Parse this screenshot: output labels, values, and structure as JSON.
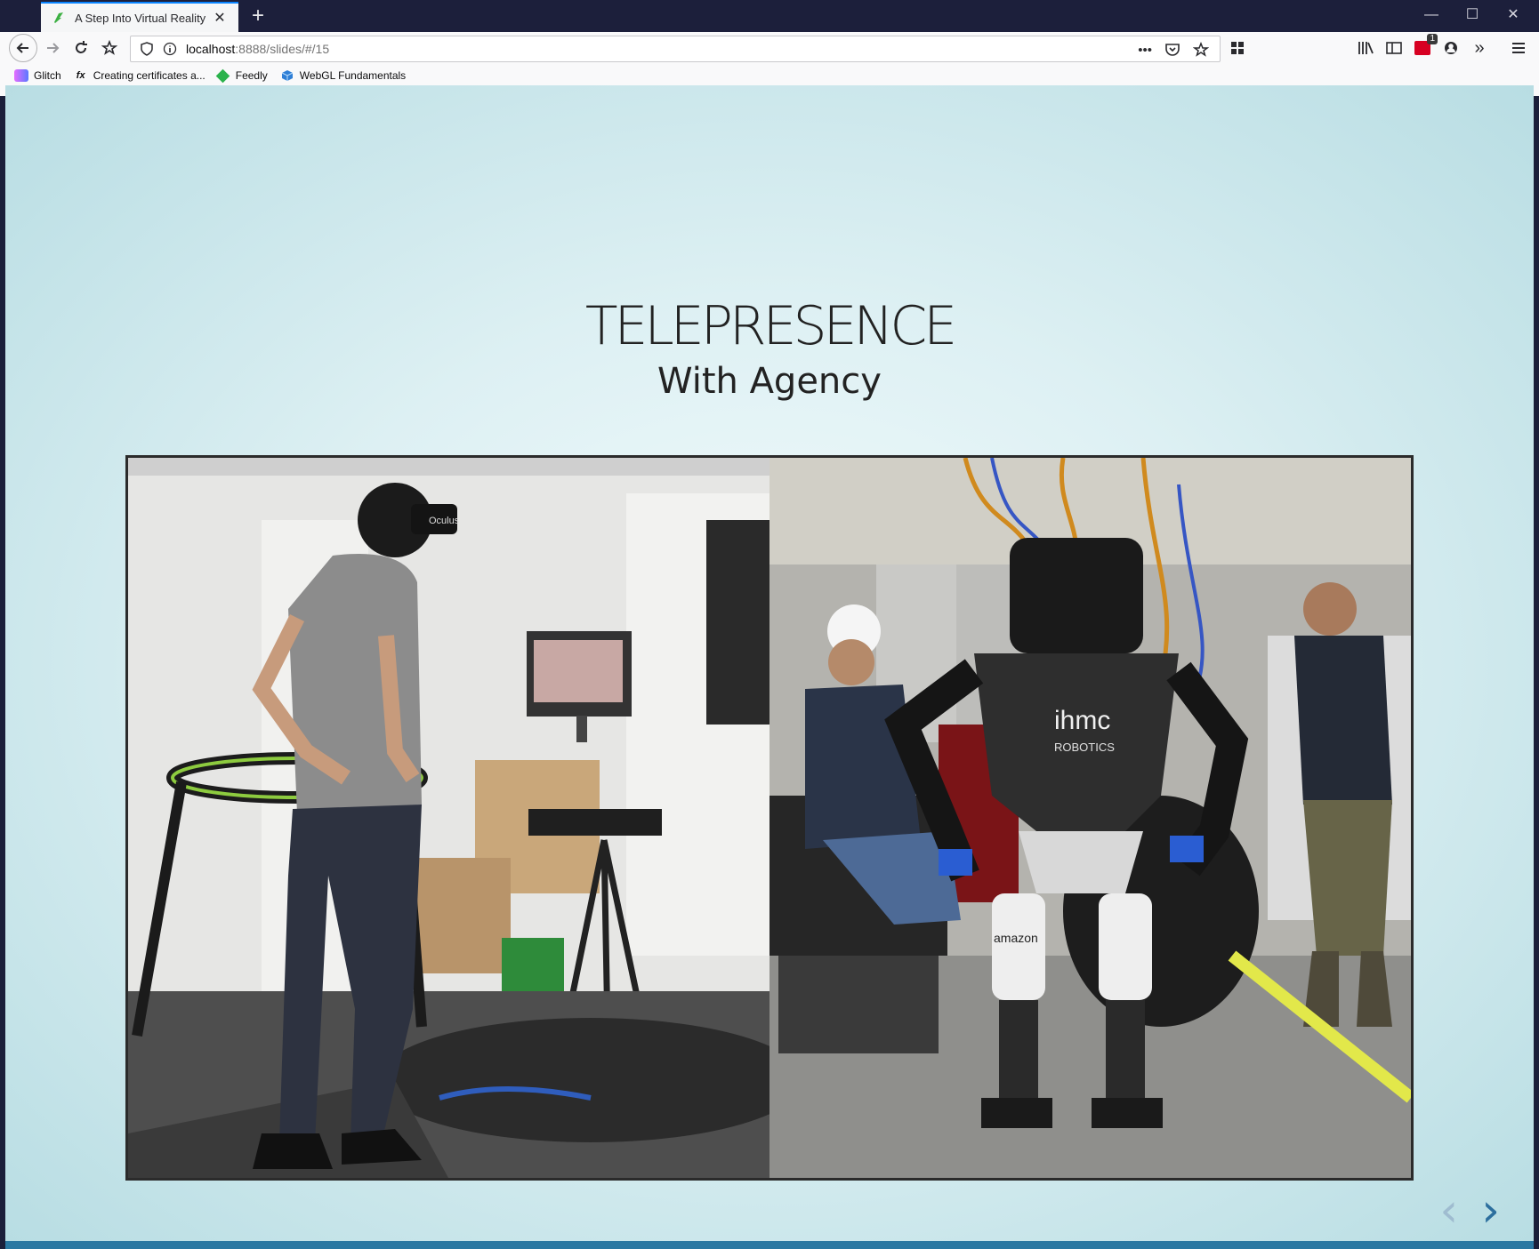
{
  "browser": {
    "tab_title": "A Step Into Virtual Reality",
    "url_host": "localhost",
    "url_path": ":8888/slides/#/15",
    "new_tab": "+",
    "bookmarks": [
      {
        "label": "Glitch",
        "icon": "glitch-icon"
      },
      {
        "label": "Creating certificates a...",
        "icon": "fx-icon"
      },
      {
        "label": "Feedly",
        "icon": "feedly-icon"
      },
      {
        "label": "WebGL Fundamentals",
        "icon": "webgl-icon"
      }
    ],
    "notification_badge": "1",
    "colors": {
      "tab_accent": "#0a84ff",
      "titlebar": "#1c1f3b"
    }
  },
  "slide": {
    "title": "TELEPRESENCE",
    "subtitle": "With Agency",
    "photo_left_desc_icon": "vr-treadmill-photo",
    "photo_right_desc_icon": "humanoid-robot-photo",
    "left_text_headset": "Oculus",
    "right_text_logo": "ihmc",
    "right_text_logo_sub": "ROBOTICS",
    "right_text_leg": "amazon",
    "prev_arrow": "‹",
    "next_arrow": "›",
    "colors": {
      "accent": "#2d6f9e",
      "bg_center": "#f2fbfc",
      "bg_edge": "#b8dde3"
    }
  }
}
